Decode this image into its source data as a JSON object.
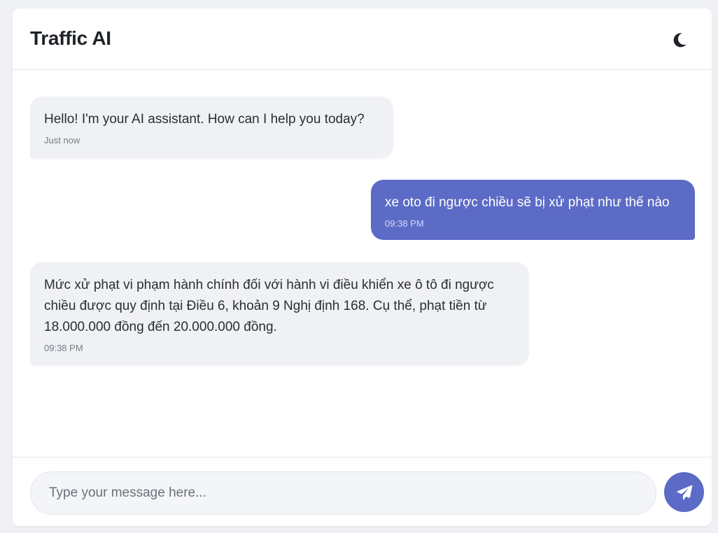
{
  "header": {
    "title": "Traffic AI",
    "theme_icon": "moon-icon"
  },
  "messages": [
    {
      "role": "assistant",
      "text": "Hello! I'm your AI assistant. How can I help you today?",
      "time": "Just now"
    },
    {
      "role": "user",
      "text": "xe oto đi ngược chiều sẽ bị xử phạt như thế nào",
      "time": "09:38 PM"
    },
    {
      "role": "assistant",
      "text": "Mức xử phạt vi phạm hành chính đối với hành vi điều khiển xe ô tô đi ngược chiều được quy định tại Điều 6, khoản 9 Nghị định 168. Cụ thể, phạt tiền từ 18.000.000 đồng đến 20.000.000 đồng.",
      "time": "09:38 PM"
    }
  ],
  "composer": {
    "placeholder": "Type your message here...",
    "value": "",
    "send_icon": "send-icon"
  },
  "colors": {
    "accent": "#5c6bc6",
    "bot_bubble": "#f0f1f5",
    "background": "#eef0f4"
  }
}
